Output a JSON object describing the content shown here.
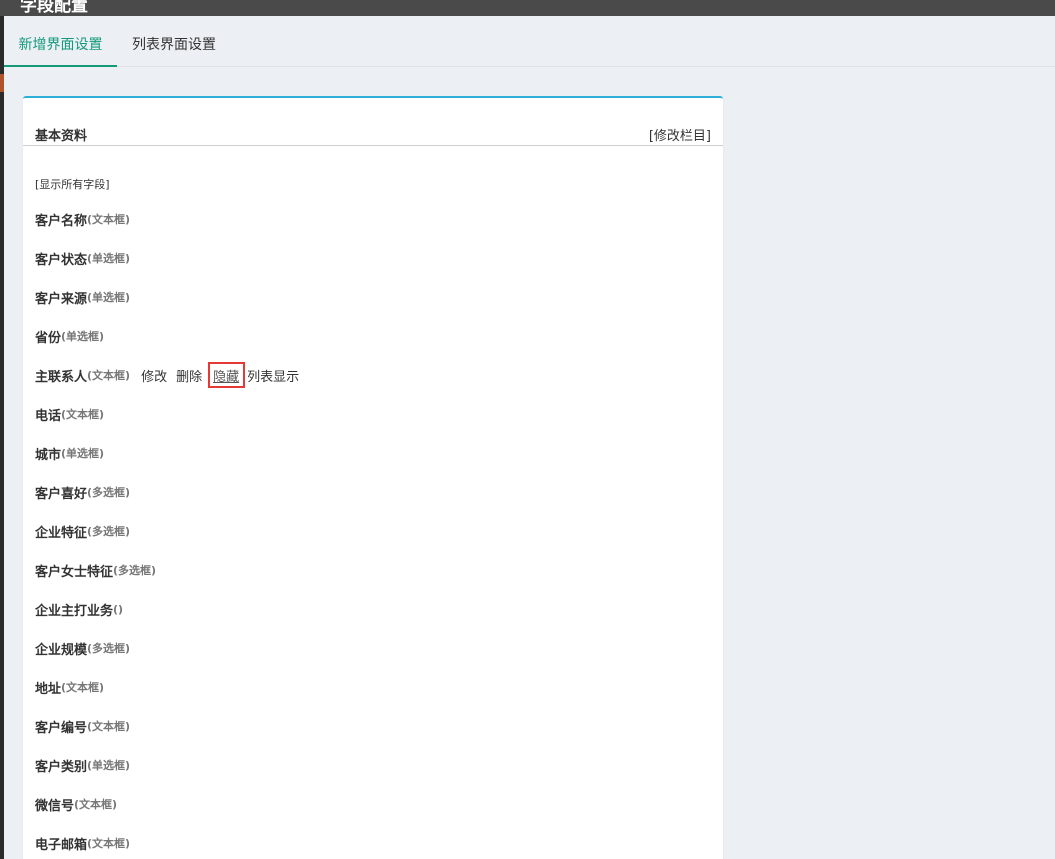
{
  "window": {
    "title": "字段配置"
  },
  "tabs": [
    {
      "label": "新增界面设置",
      "active": true
    },
    {
      "label": "列表界面设置",
      "active": false
    }
  ],
  "section": {
    "title": "基本资料",
    "edit_columns_label": "[修改栏目]",
    "show_all_label": "[显示所有字段]"
  },
  "fields": [
    {
      "name": "客户名称",
      "type": "(文本框)"
    },
    {
      "name": "客户状态",
      "type": "(单选框)"
    },
    {
      "name": "客户来源",
      "type": "(单选框)"
    },
    {
      "name": "省份",
      "type": "(单选框)"
    },
    {
      "name": "主联系人",
      "type": "(文本框)"
    },
    {
      "name": "电话",
      "type": "(文本框)"
    },
    {
      "name": "城市",
      "type": "(单选框)"
    },
    {
      "name": "客户喜好",
      "type": "(多选框)"
    },
    {
      "name": "企业特征",
      "type": "(多选框)"
    },
    {
      "name": "客户女士特征",
      "type": "(多选框)"
    },
    {
      "name": "企业主打业务",
      "type": "()"
    },
    {
      "name": "企业规模",
      "type": "(多选框)"
    },
    {
      "name": "地址",
      "type": "(文本框)"
    },
    {
      "name": "客户编号",
      "type": "(文本框)"
    },
    {
      "name": "客户类别",
      "type": "(单选框)"
    },
    {
      "name": "微信号",
      "type": "(文本框)"
    },
    {
      "name": "电子邮箱",
      "type": "(文本框)"
    }
  ],
  "row_actions": {
    "edit_label": "修改",
    "delete_label": "删除",
    "hide_label": "隐藏",
    "list_display_label": "列表显示"
  },
  "colors": {
    "active_tab": "#149a7b",
    "card_top_border": "#2cb0d8",
    "highlight_box": "#e53935"
  }
}
